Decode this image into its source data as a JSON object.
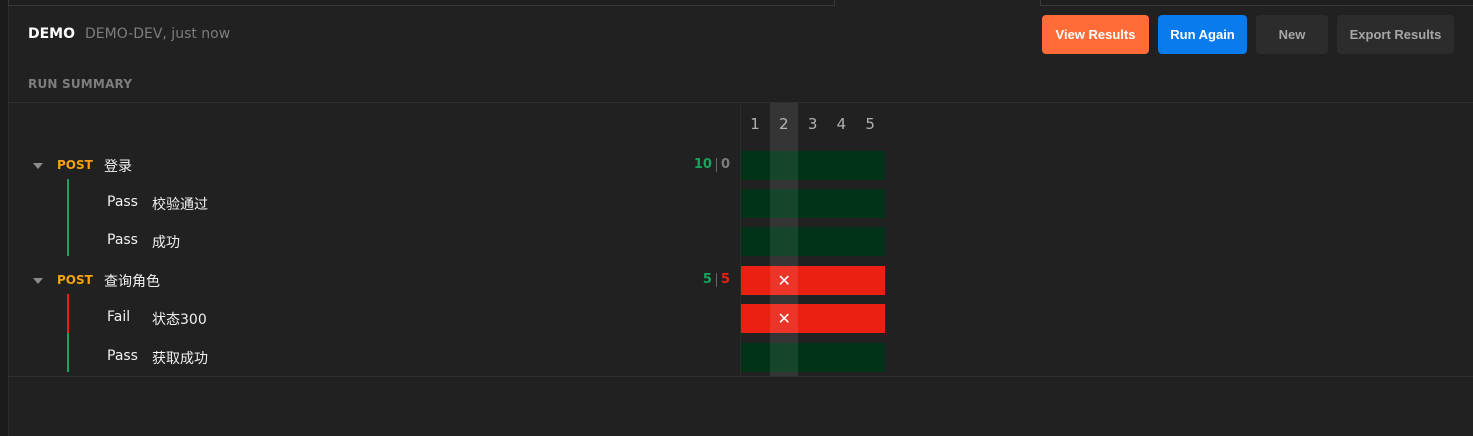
{
  "header": {
    "title": "DEMO",
    "meta": "DEMO-DEV, just now"
  },
  "actions": {
    "view_results": "View Results",
    "run_again": "Run Again",
    "new": "New",
    "export_results": "Export Results"
  },
  "summary": {
    "section_label": "RUN SUMMARY",
    "iterations": [
      "1",
      "2",
      "3",
      "4",
      "5"
    ],
    "highlighted_iteration": "2",
    "requests": [
      {
        "method": "POST",
        "name": "登录",
        "passed": "10",
        "failed": "0",
        "results": [
          "pass",
          "pass",
          "pass",
          "pass",
          "pass"
        ],
        "assertions": [
          {
            "status": "Pass",
            "name": "校验通过",
            "results": [
              "pass",
              "pass",
              "pass",
              "pass",
              "pass"
            ]
          },
          {
            "status": "Pass",
            "name": "成功",
            "results": [
              "pass",
              "pass",
              "pass",
              "pass",
              "pass"
            ]
          }
        ]
      },
      {
        "method": "POST",
        "name": "查询角色",
        "passed": "5",
        "failed": "5",
        "results": [
          "fail",
          "fail",
          "fail",
          "fail",
          "fail"
        ],
        "assertions": [
          {
            "status": "Fail",
            "name": "状态300",
            "results": [
              "fail",
              "fail",
              "fail",
              "fail",
              "fail"
            ]
          },
          {
            "status": "Pass",
            "name": "获取成功",
            "results": [
              "pass",
              "pass",
              "pass",
              "pass",
              "pass"
            ]
          }
        ]
      }
    ]
  },
  "colors": {
    "accent_orange": "#ff6c37",
    "accent_blue": "#097bed",
    "pass_green": "#1aa35a",
    "pass_cell": "#003317",
    "fail_red": "#eb2013",
    "method_post": "#f4a30c"
  },
  "icons": {
    "expand": "caret-down-icon",
    "failure_marker": "close-icon"
  }
}
